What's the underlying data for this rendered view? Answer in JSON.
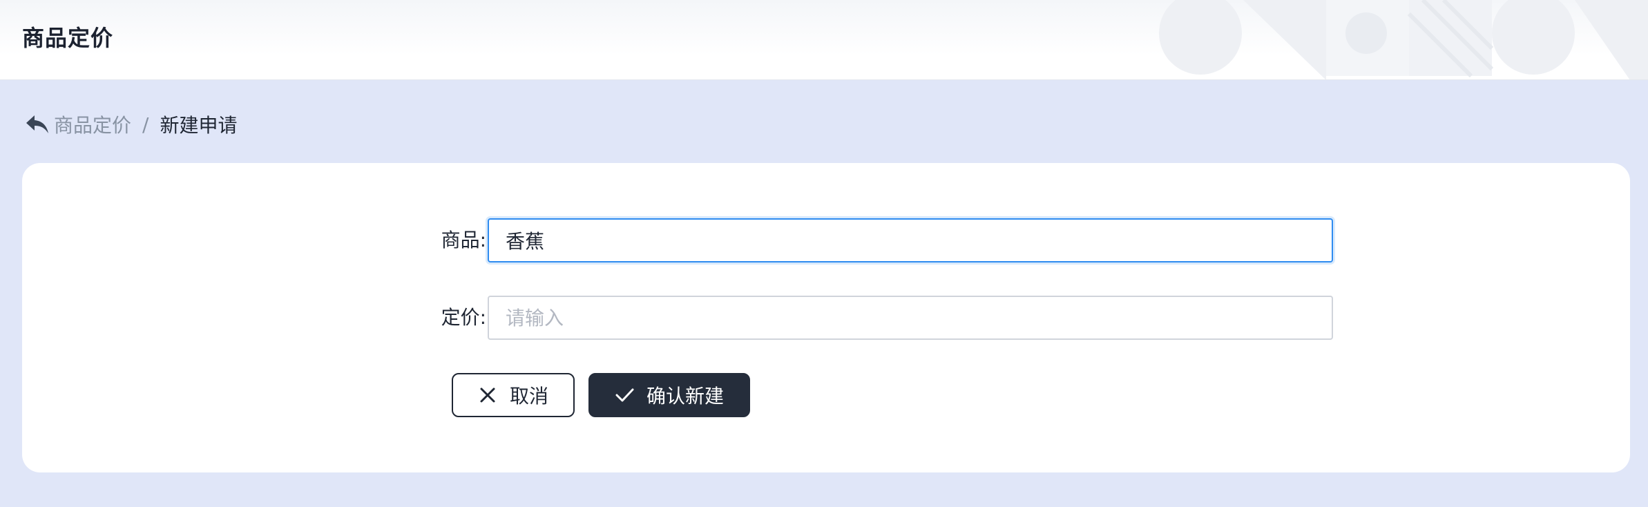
{
  "header": {
    "title": "商品定价"
  },
  "breadcrumb": {
    "back_icon": "back-arrow-icon",
    "parent": "商品定价",
    "separator": "/",
    "current": "新建申请"
  },
  "form": {
    "product": {
      "label": "商品:",
      "value": "香蕉",
      "placeholder": ""
    },
    "price": {
      "label": "定价:",
      "value": "",
      "placeholder": "请输入"
    }
  },
  "actions": {
    "cancel_label": "取消",
    "cancel_icon": "close-icon",
    "confirm_label": "确认新建",
    "confirm_icon": "check-icon"
  },
  "colors": {
    "page_bg": "#e0e6f8",
    "card_bg": "#ffffff",
    "primary_button": "#252d3b",
    "focus_border": "#2f8cf0"
  }
}
